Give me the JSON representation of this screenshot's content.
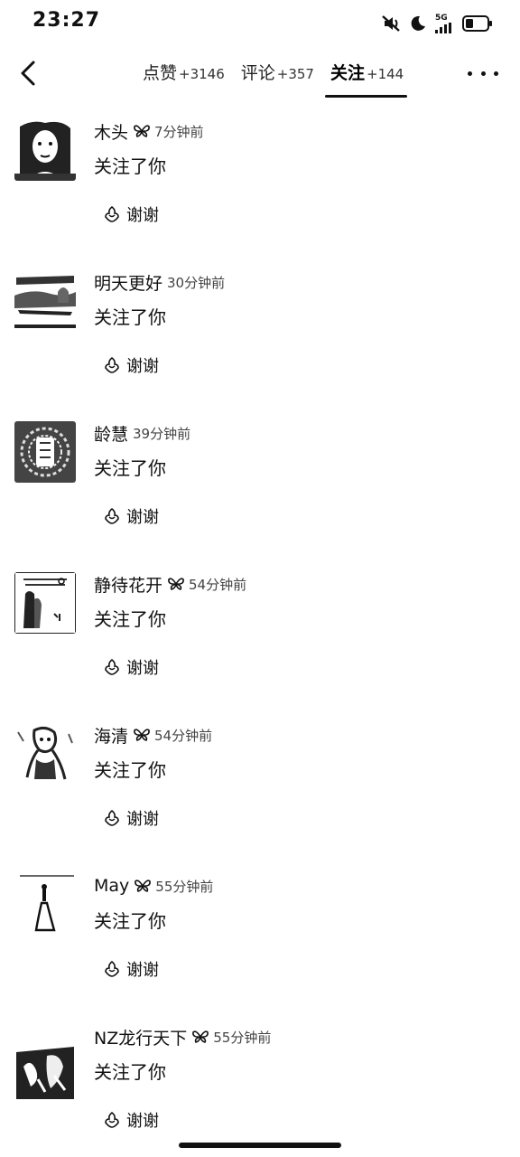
{
  "status_bar": {
    "time": "23:27",
    "network": "5G"
  },
  "nav": {
    "tabs": [
      {
        "label": "点赞",
        "count": "+3146",
        "active": false
      },
      {
        "label": "评论",
        "count": "+357",
        "active": false
      },
      {
        "label": "关注",
        "count": "+144",
        "active": true
      }
    ]
  },
  "notifications": [
    {
      "name": "木头",
      "badge": true,
      "time": "7分钟前",
      "action": "关注了你",
      "thanks": "谢谢",
      "avatar": "portrait-woman"
    },
    {
      "name": "明天更好",
      "badge": false,
      "time": "30分钟前",
      "action": "关注了你",
      "thanks": "谢谢",
      "avatar": "landscape"
    },
    {
      "name": "龄慧",
      "badge": false,
      "time": "39分钟前",
      "action": "关注了你",
      "thanks": "谢谢",
      "avatar": "pattern"
    },
    {
      "name": "静待花开",
      "badge": true,
      "time": "54分钟前",
      "action": "关注了你",
      "thanks": "谢谢",
      "avatar": "poster"
    },
    {
      "name": "海清",
      "badge": true,
      "time": "54分钟前",
      "action": "关注了你",
      "thanks": "谢谢",
      "avatar": "girl-sketch"
    },
    {
      "name": "May",
      "badge": true,
      "time": "55分钟前",
      "action": "关注了你",
      "thanks": "谢谢",
      "avatar": "figure"
    },
    {
      "name": "NZ龙行天下",
      "badge": true,
      "time": "55分钟前",
      "action": "关注了你",
      "thanks": "谢谢",
      "avatar": "abstract"
    }
  ]
}
